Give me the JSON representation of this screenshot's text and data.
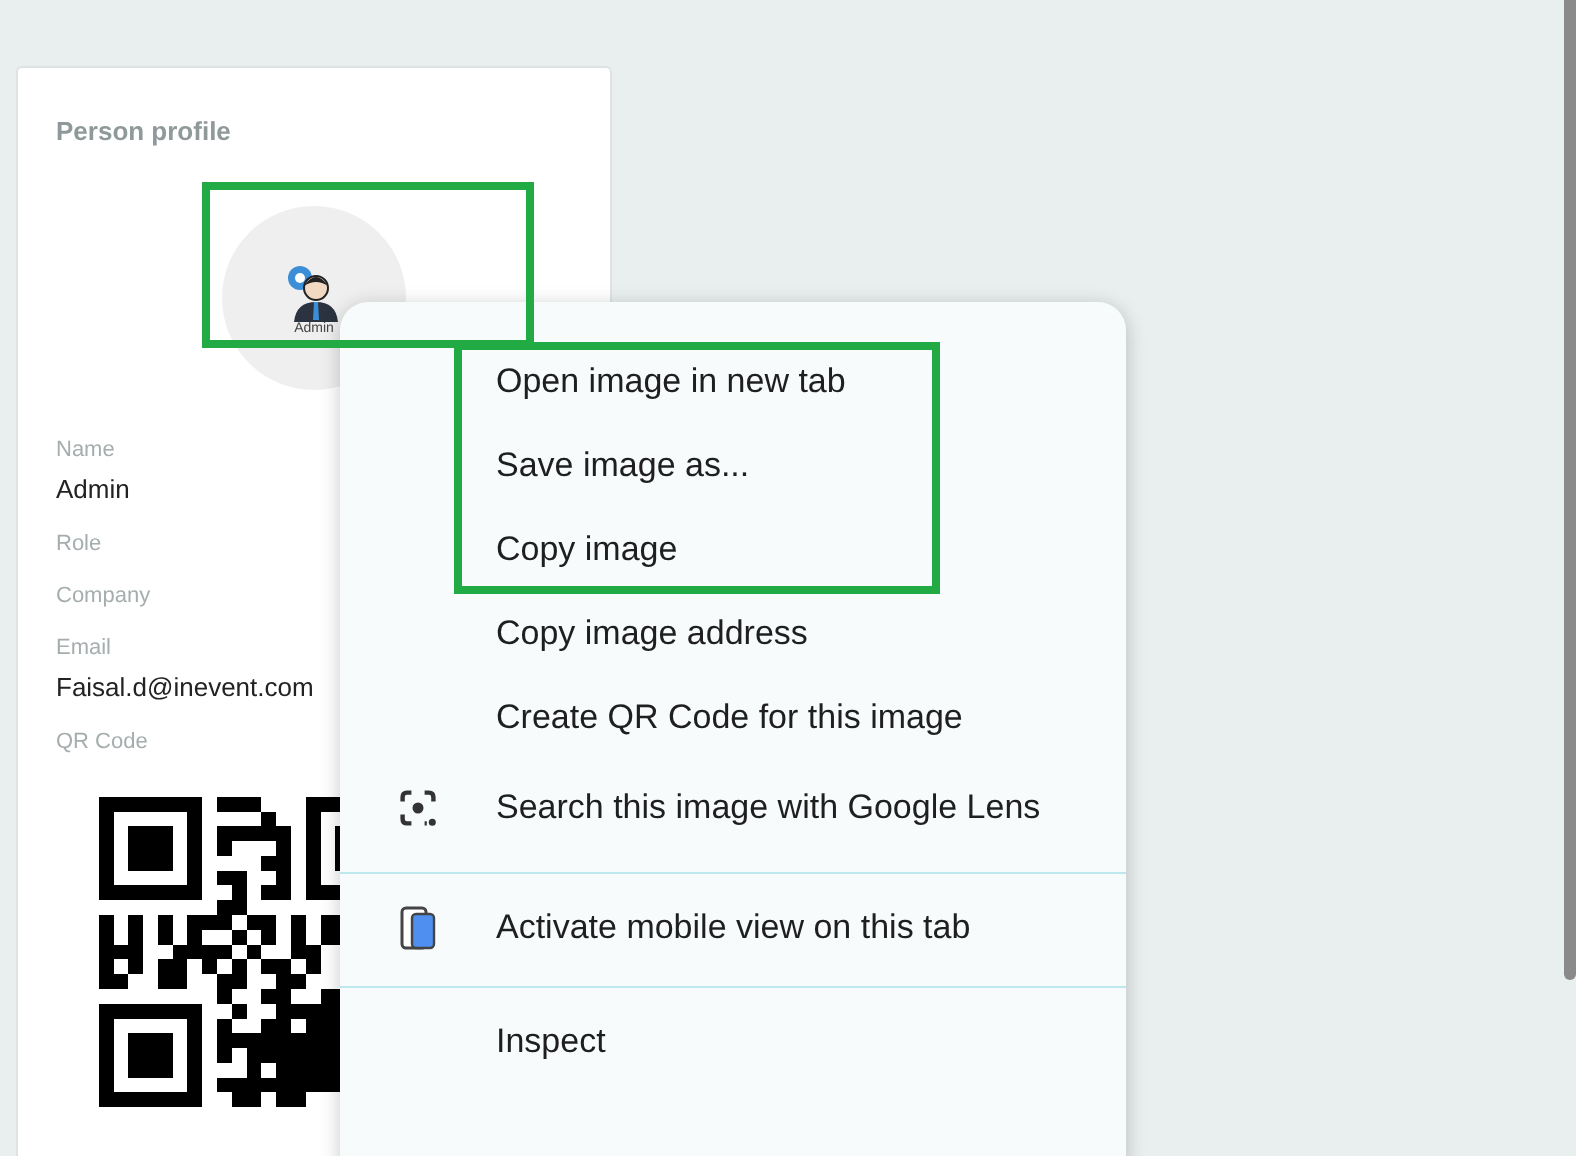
{
  "profile": {
    "title": "Person profile",
    "avatar_caption": "Admin",
    "fields": [
      {
        "label": "Name",
        "value": "Admin"
      },
      {
        "label": "Role"
      },
      {
        "label": "Company"
      },
      {
        "label": "Email",
        "value": "Faisal.d@inevent.com"
      },
      {
        "label": "QR Code"
      }
    ]
  },
  "context_menu": {
    "groups": [
      [
        {
          "label": "Open image in new tab",
          "kind": "plain"
        },
        {
          "label": "Save image as...",
          "kind": "plain"
        },
        {
          "label": "Copy image",
          "kind": "plain"
        },
        {
          "label": "Copy image address",
          "kind": "plain"
        },
        {
          "label": "Create QR Code for this image",
          "kind": "plain"
        },
        {
          "label": "Search this image with Google Lens",
          "kind": "lens"
        }
      ],
      [
        {
          "label": "Activate mobile view on this tab",
          "kind": "mobile"
        }
      ],
      [
        {
          "label": "Inspect",
          "kind": "plain"
        }
      ]
    ]
  }
}
